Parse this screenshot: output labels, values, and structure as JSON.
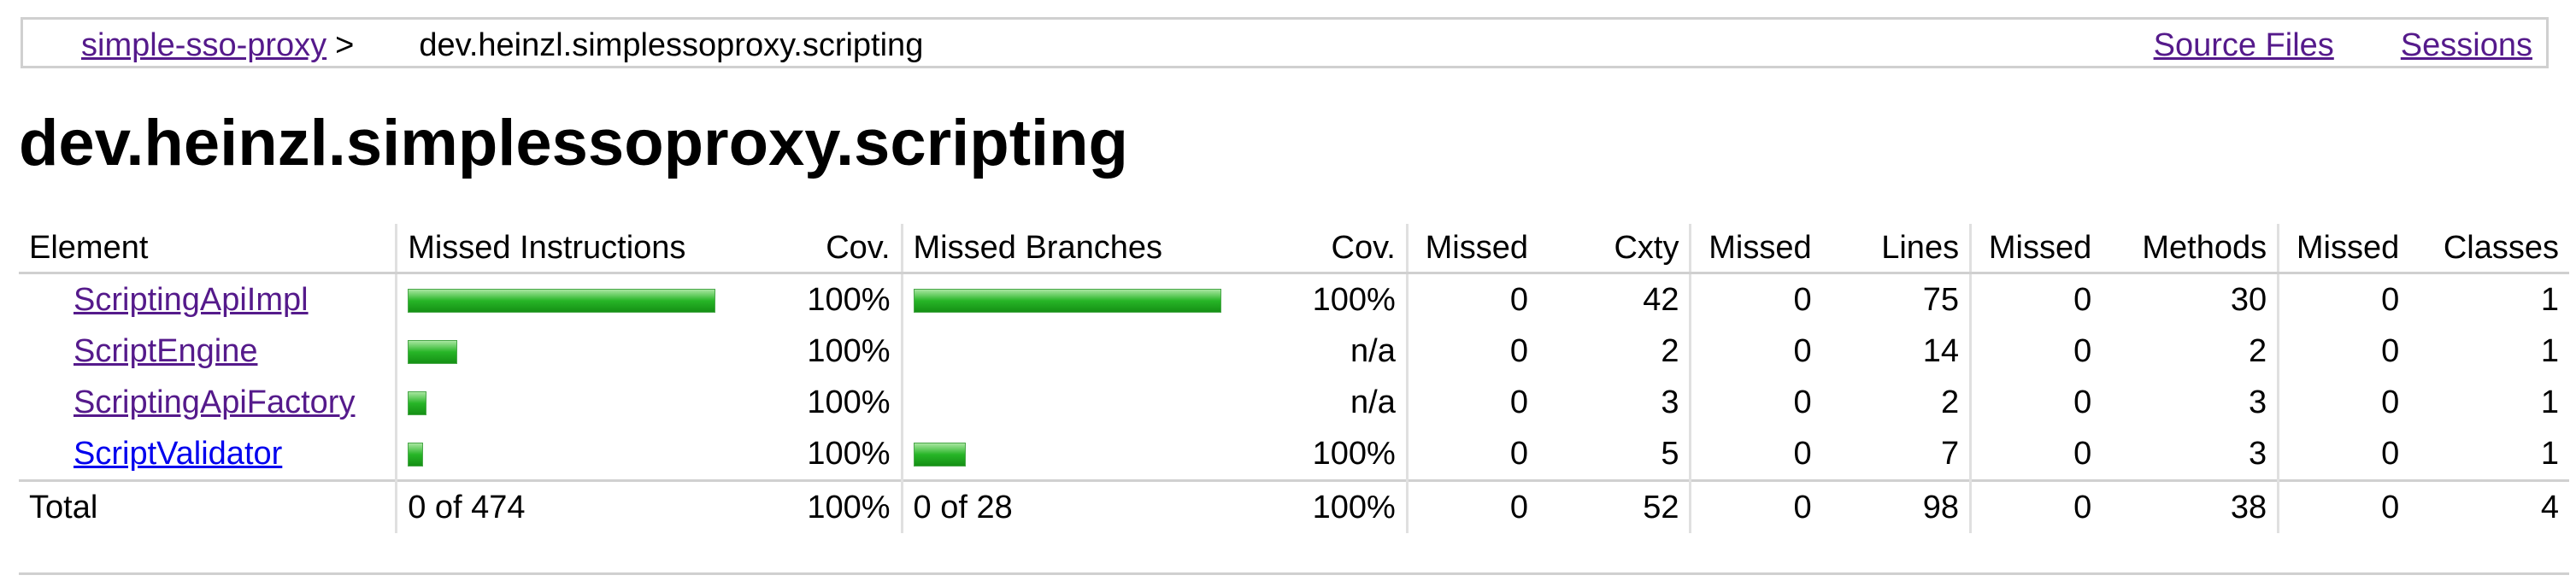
{
  "breadcrumb": {
    "root": "simple-sso-proxy",
    "separator": ">",
    "current": "dev.heinzl.simplessoproxy.scripting",
    "links": [
      "Source Files",
      "Sessions"
    ]
  },
  "page_title": "dev.heinzl.simplessoproxy.scripting",
  "table": {
    "headers": [
      "Element",
      "Missed Instructions",
      "Cov.",
      "Missed Branches",
      "Cov.",
      "Missed",
      "Cxty",
      "Missed",
      "Lines",
      "Missed",
      "Methods",
      "Missed",
      "Classes"
    ],
    "rows": [
      {
        "element": "ScriptingApiImpl",
        "instr_cov": "100%",
        "branch_cov": "100%",
        "missed_cxty": "0",
        "cxty": "42",
        "missed_lines": "0",
        "lines": "75",
        "missed_methods": "0",
        "methods": "30",
        "missed_classes": "0",
        "classes": "1",
        "instr_bar_fraction": 1.0,
        "branch_bar_fraction": 1.0
      },
      {
        "element": "ScriptEngine",
        "instr_cov": "100%",
        "branch_cov": "n/a",
        "missed_cxty": "0",
        "cxty": "2",
        "missed_lines": "0",
        "lines": "14",
        "missed_methods": "0",
        "methods": "2",
        "missed_classes": "0",
        "classes": "1",
        "instr_bar_fraction": 0.16,
        "branch_bar_fraction": 0
      },
      {
        "element": "ScriptingApiFactory",
        "instr_cov": "100%",
        "branch_cov": "n/a",
        "missed_cxty": "0",
        "cxty": "3",
        "missed_lines": "0",
        "lines": "2",
        "missed_methods": "0",
        "methods": "3",
        "missed_classes": "0",
        "classes": "1",
        "instr_bar_fraction": 0.06,
        "branch_bar_fraction": 0
      },
      {
        "element": "ScriptValidator",
        "instr_cov": "100%",
        "branch_cov": "100%",
        "missed_cxty": "0",
        "cxty": "5",
        "missed_lines": "0",
        "lines": "7",
        "missed_methods": "0",
        "methods": "3",
        "missed_classes": "0",
        "classes": "1",
        "instr_bar_fraction": 0.05,
        "branch_bar_fraction": 0.17
      }
    ],
    "total": {
      "label": "Total",
      "instr": "0 of 474",
      "instr_cov": "100%",
      "branch": "0 of 28",
      "branch_cov": "100%",
      "missed_cxty": "0",
      "cxty": "52",
      "missed_lines": "0",
      "lines": "98",
      "missed_methods": "0",
      "methods": "38",
      "missed_classes": "0",
      "classes": "4"
    }
  },
  "colors": {
    "link_visited": "#551a8b",
    "link_unvisited": "#0000ee",
    "bar_green": "#27b527",
    "rule_gray": "#d0d0d0"
  }
}
